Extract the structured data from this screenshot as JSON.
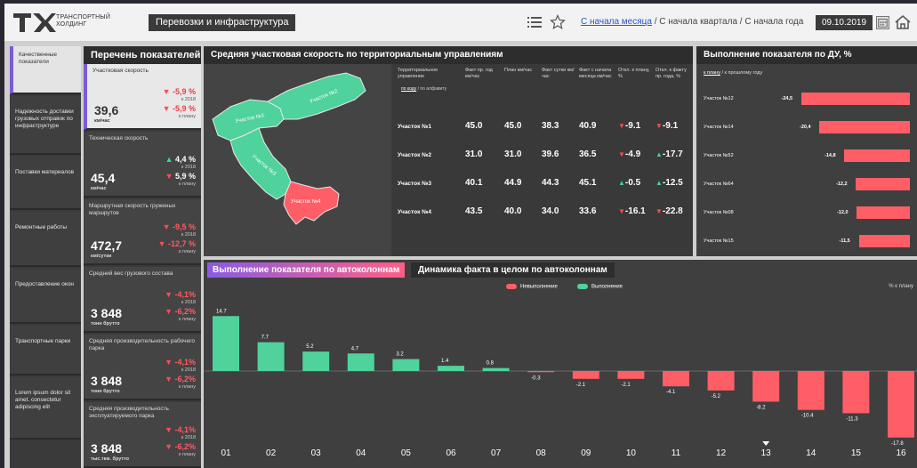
{
  "header": {
    "logo_line1": "ТРАНСПОРТНЫЙ",
    "logo_line2": "ХОЛДИНГ",
    "section": "Перевозки и инфраструктура",
    "period_month": "С начала месяца",
    "period_rest": " / С начала квартала / С начала года",
    "date": "09.10.2019",
    "icons": [
      "list-icon",
      "star-icon",
      "calendar-icon",
      "home-icon"
    ]
  },
  "nav": [
    {
      "label": "Качественные показатели",
      "active": true
    },
    {
      "label": "Надежность доставки грузовых отправок по инфраструктуре"
    },
    {
      "label": "Поставки материалов"
    },
    {
      "label": "Ремонтные работы"
    },
    {
      "label": "Предоставление окон"
    },
    {
      "label": "Транспортные парки"
    },
    {
      "label": "Lorem ipsum dolor sit amet. consectetur adipiscing elit"
    }
  ],
  "indicators": {
    "title": "Перечень показателей",
    "cards": [
      {
        "label": "Участковая скорость",
        "value": "39,6",
        "unit": "км/час",
        "d1": "-5,9 %",
        "s1": "к 2018",
        "d2": "-5,9 %",
        "s2": "к плану",
        "t1": "dn",
        "t2": "dn"
      },
      {
        "label": "Техническая скорость",
        "value": "45,4",
        "unit": "км/час",
        "d1": "4,4 %",
        "s1": "к 2018",
        "d2": "5,9 %",
        "s2": "к плану",
        "t1": "up",
        "t2": "dn"
      },
      {
        "label": "Маршрутная скорость груженых маршрутов",
        "value": "472,7",
        "unit": "км/сутки",
        "d1": "-9,5 %",
        "s1": "к 2018",
        "d2": "-12,7 %",
        "s2": "к плану",
        "t1": "dn",
        "t2": "dn"
      },
      {
        "label": "Средний вес грузового состава",
        "value": "3 848",
        "unit": "тонн брутто",
        "d1": "-4,1%",
        "s1": "к 2018",
        "d2": "-6,2%",
        "s2": "к плану",
        "t1": "dn",
        "t2": "dn"
      },
      {
        "label": "Средняя производительность рабочего парка",
        "value": "3 848",
        "unit": "тонн брутто",
        "d1": "-4,1%",
        "s1": "к 2018",
        "d2": "-6,2%",
        "s2": "к плану",
        "t1": "dn",
        "t2": "dn"
      },
      {
        "label": "Средняя производительность эксплуатируемого парка",
        "value": "3 848",
        "unit": "тыс.ткм. брутто",
        "d1": "-4,1%",
        "s1": "к 2018",
        "d2": "-6,2%",
        "s2": "к плану",
        "t1": "dn",
        "t2": "dn"
      }
    ]
  },
  "speed": {
    "title": "Средняя участковая скорость по территориальным управлениям",
    "map_labels": [
      "Участок №1",
      "Участок №2",
      "Участок №3",
      "Участок №4"
    ],
    "headers": [
      "Территориальное управление",
      "Факт пр. год км/час",
      "План км/час",
      "Факт сутки км/час",
      "Факт с начала месяца км/час",
      "Откл. к плану, %",
      "Откл. к факту пр. года, %"
    ],
    "sort_by": "по коду",
    "sort_rest": " / по алфавиту",
    "rows": [
      {
        "name": "Участок №1",
        "vals": [
          "45.0",
          "45.0",
          "38.3",
          "40.9"
        ],
        "o1": "-9.1",
        "o1t": "dn",
        "o2": "-9.1",
        "o2t": "dn"
      },
      {
        "name": "Участок №2",
        "vals": [
          "31.0",
          "31.0",
          "39.6",
          "36.5"
        ],
        "o1": "-4.9",
        "o1t": "dn",
        "o2": "-17.7",
        "o2t": "up"
      },
      {
        "name": "Участок №3",
        "vals": [
          "40.1",
          "44.9",
          "44.3",
          "45.1"
        ],
        "o1": "-0.5",
        "o1t": "up",
        "o2": "-12.5",
        "o2t": "up"
      },
      {
        "name": "Участок №4",
        "vals": [
          "43.5",
          "40.0",
          "34.0",
          "33.6"
        ],
        "o1": "-16.1",
        "o1t": "dn",
        "o2": "-22.8",
        "o2t": "dn"
      }
    ]
  },
  "du": {
    "title": "Выполнение показателя по ДУ, %",
    "sub_link": "к плану",
    "sub_rest": " / к прошлому году",
    "rows": [
      {
        "name": "Участок №12",
        "value": "-24,5",
        "v": -24.5
      },
      {
        "name": "Участок №14",
        "value": "-20,4",
        "v": -20.4
      },
      {
        "name": "Участок №52",
        "value": "-14,8",
        "v": -14.8
      },
      {
        "name": "Участок №64",
        "value": "-12,2",
        "v": -12.2
      },
      {
        "name": "Участок №08",
        "value": "-12,0",
        "v": -12.0
      },
      {
        "name": "Участок №15",
        "value": "-11,5",
        "v": -11.5
      }
    ]
  },
  "bottom": {
    "tab_active": "Выполнение показателя по автоколоннам",
    "tab_other": "Динамика факта в целом по автоколоннам",
    "legend_neg": "Невыполнение",
    "legend_pos": "Выполнение",
    "unit_label": "% к плану",
    "colors": {
      "pos": "#4fd29b",
      "neg": "#ff5e66"
    }
  },
  "chart_data": {
    "type": "bar",
    "categories": [
      "01",
      "02",
      "03",
      "04",
      "05",
      "06",
      "07",
      "08",
      "09",
      "10",
      "11",
      "12",
      "13",
      "14",
      "15",
      "16"
    ],
    "values": [
      14.7,
      7.7,
      5.2,
      4.7,
      3.2,
      1.4,
      0.8,
      -0.3,
      -2.1,
      -2.1,
      -4.1,
      -5.2,
      -8.2,
      -10.4,
      -11.3,
      -17.8
    ],
    "labels": [
      "14.7",
      "7.7",
      "5.2",
      "4.7",
      "3.2",
      "1.4",
      "0.8",
      "-0.3",
      "-2.1",
      "-2.1",
      "-4.1",
      "-5.2",
      "-8.2",
      "-10.4",
      "-11.3",
      "-17.8"
    ],
    "ylabel": "% к плану",
    "selected_category": "13"
  }
}
